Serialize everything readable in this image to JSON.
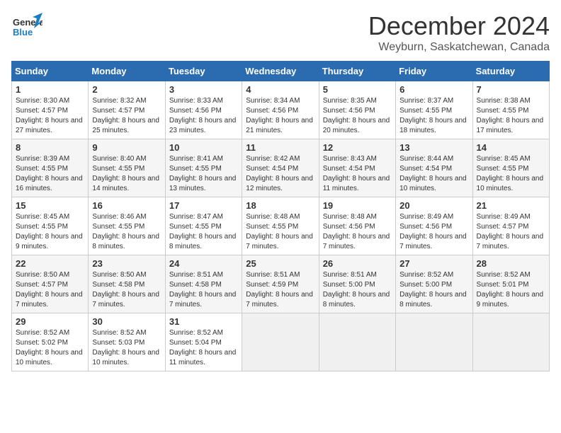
{
  "logo": {
    "line1": "General",
    "line2": "Blue"
  },
  "title": "December 2024",
  "subtitle": "Weyburn, Saskatchewan, Canada",
  "days_of_week": [
    "Sunday",
    "Monday",
    "Tuesday",
    "Wednesday",
    "Thursday",
    "Friday",
    "Saturday"
  ],
  "weeks": [
    [
      {
        "day": "1",
        "sunrise": "8:30 AM",
        "sunset": "4:57 PM",
        "daylight": "8 hours and 27 minutes."
      },
      {
        "day": "2",
        "sunrise": "8:32 AM",
        "sunset": "4:57 PM",
        "daylight": "8 hours and 25 minutes."
      },
      {
        "day": "3",
        "sunrise": "8:33 AM",
        "sunset": "4:56 PM",
        "daylight": "8 hours and 23 minutes."
      },
      {
        "day": "4",
        "sunrise": "8:34 AM",
        "sunset": "4:56 PM",
        "daylight": "8 hours and 21 minutes."
      },
      {
        "day": "5",
        "sunrise": "8:35 AM",
        "sunset": "4:56 PM",
        "daylight": "8 hours and 20 minutes."
      },
      {
        "day": "6",
        "sunrise": "8:37 AM",
        "sunset": "4:55 PM",
        "daylight": "8 hours and 18 minutes."
      },
      {
        "day": "7",
        "sunrise": "8:38 AM",
        "sunset": "4:55 PM",
        "daylight": "8 hours and 17 minutes."
      }
    ],
    [
      {
        "day": "8",
        "sunrise": "8:39 AM",
        "sunset": "4:55 PM",
        "daylight": "8 hours and 16 minutes."
      },
      {
        "day": "9",
        "sunrise": "8:40 AM",
        "sunset": "4:55 PM",
        "daylight": "8 hours and 14 minutes."
      },
      {
        "day": "10",
        "sunrise": "8:41 AM",
        "sunset": "4:55 PM",
        "daylight": "8 hours and 13 minutes."
      },
      {
        "day": "11",
        "sunrise": "8:42 AM",
        "sunset": "4:54 PM",
        "daylight": "8 hours and 12 minutes."
      },
      {
        "day": "12",
        "sunrise": "8:43 AM",
        "sunset": "4:54 PM",
        "daylight": "8 hours and 11 minutes."
      },
      {
        "day": "13",
        "sunrise": "8:44 AM",
        "sunset": "4:54 PM",
        "daylight": "8 hours and 10 minutes."
      },
      {
        "day": "14",
        "sunrise": "8:45 AM",
        "sunset": "4:55 PM",
        "daylight": "8 hours and 10 minutes."
      }
    ],
    [
      {
        "day": "15",
        "sunrise": "8:45 AM",
        "sunset": "4:55 PM",
        "daylight": "8 hours and 9 minutes."
      },
      {
        "day": "16",
        "sunrise": "8:46 AM",
        "sunset": "4:55 PM",
        "daylight": "8 hours and 8 minutes."
      },
      {
        "day": "17",
        "sunrise": "8:47 AM",
        "sunset": "4:55 PM",
        "daylight": "8 hours and 8 minutes."
      },
      {
        "day": "18",
        "sunrise": "8:48 AM",
        "sunset": "4:55 PM",
        "daylight": "8 hours and 7 minutes."
      },
      {
        "day": "19",
        "sunrise": "8:48 AM",
        "sunset": "4:56 PM",
        "daylight": "8 hours and 7 minutes."
      },
      {
        "day": "20",
        "sunrise": "8:49 AM",
        "sunset": "4:56 PM",
        "daylight": "8 hours and 7 minutes."
      },
      {
        "day": "21",
        "sunrise": "8:49 AM",
        "sunset": "4:57 PM",
        "daylight": "8 hours and 7 minutes."
      }
    ],
    [
      {
        "day": "22",
        "sunrise": "8:50 AM",
        "sunset": "4:57 PM",
        "daylight": "8 hours and 7 minutes."
      },
      {
        "day": "23",
        "sunrise": "8:50 AM",
        "sunset": "4:58 PM",
        "daylight": "8 hours and 7 minutes."
      },
      {
        "day": "24",
        "sunrise": "8:51 AM",
        "sunset": "4:58 PM",
        "daylight": "8 hours and 7 minutes."
      },
      {
        "day": "25",
        "sunrise": "8:51 AM",
        "sunset": "4:59 PM",
        "daylight": "8 hours and 7 minutes."
      },
      {
        "day": "26",
        "sunrise": "8:51 AM",
        "sunset": "5:00 PM",
        "daylight": "8 hours and 8 minutes."
      },
      {
        "day": "27",
        "sunrise": "8:52 AM",
        "sunset": "5:00 PM",
        "daylight": "8 hours and 8 minutes."
      },
      {
        "day": "28",
        "sunrise": "8:52 AM",
        "sunset": "5:01 PM",
        "daylight": "8 hours and 9 minutes."
      }
    ],
    [
      {
        "day": "29",
        "sunrise": "8:52 AM",
        "sunset": "5:02 PM",
        "daylight": "8 hours and 10 minutes."
      },
      {
        "day": "30",
        "sunrise": "8:52 AM",
        "sunset": "5:03 PM",
        "daylight": "8 hours and 10 minutes."
      },
      {
        "day": "31",
        "sunrise": "8:52 AM",
        "sunset": "5:04 PM",
        "daylight": "8 hours and 11 minutes."
      },
      null,
      null,
      null,
      null
    ]
  ],
  "labels": {
    "sunrise": "Sunrise:",
    "sunset": "Sunset:",
    "daylight": "Daylight:"
  }
}
